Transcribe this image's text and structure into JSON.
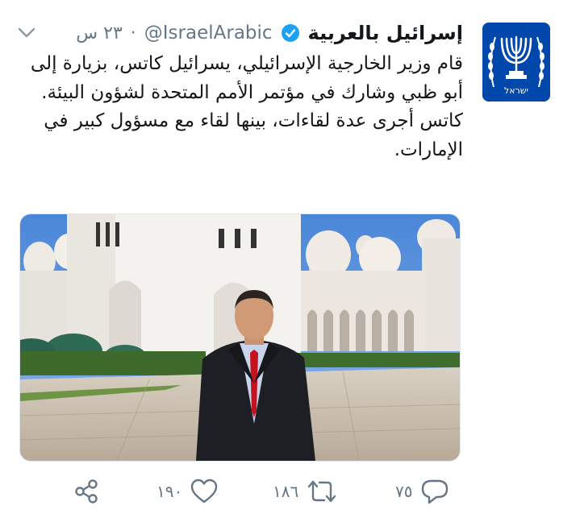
{
  "account": {
    "name": "إسرائيل بالعربية",
    "handle": "@IsraelArabic",
    "separator": "·",
    "time": "٢٣ س",
    "verified_icon": "verified-badge-icon",
    "avatar_icon": "menorah-emblem-icon",
    "avatar_caption": "ישראל"
  },
  "tweet": {
    "paragraph1": "قام وزير الخارجية الإسرائيلي، يسرائيل كاتس، بزيارة إلى أبو ظبي وشارك في مؤتمر الأمم المتحدة لشؤون البيئة.",
    "paragraph2": "كاتس أجرى عدة لقاءات، بينها لقاء مع مسؤول كبير في الإمارات."
  },
  "actions": {
    "reply_count": "٧٥",
    "retweet_count": "١٨٦",
    "like_count": "١٩٠",
    "icons": [
      "reply-icon",
      "retweet-icon",
      "like-icon",
      "share-icon"
    ]
  },
  "colors": {
    "accent": "#1da1f2",
    "avatar_bg": "#0047ab",
    "muted": "#657786",
    "text": "#14171a"
  }
}
